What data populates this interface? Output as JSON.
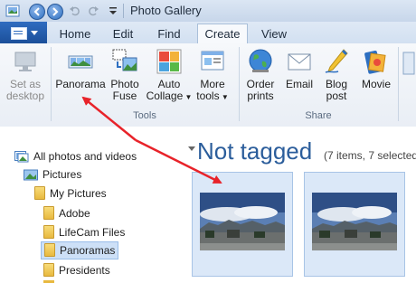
{
  "window": {
    "title": "Photo Gallery"
  },
  "quick_access": {
    "icons": [
      "back-icon",
      "forward-icon",
      "undo-icon",
      "redo-icon",
      "customize-icon"
    ]
  },
  "tabs": [
    {
      "label": "Home"
    },
    {
      "label": "Edit"
    },
    {
      "label": "Find"
    },
    {
      "label": "Create",
      "active": true
    },
    {
      "label": "View"
    }
  ],
  "ribbon": {
    "groups": [
      {
        "label": "",
        "buttons": [
          {
            "label_line1": "Set as",
            "label_line2": "desktop",
            "icon": "desktop-icon",
            "disabled": true
          }
        ]
      },
      {
        "label": "Tools",
        "buttons": [
          {
            "label_line1": "Panorama",
            "label_line2": "",
            "icon": "panorama-icon"
          },
          {
            "label_line1": "Photo",
            "label_line2": "Fuse",
            "icon": "photo-fuse-icon"
          },
          {
            "label_line1": "Auto",
            "label_line2": "Collage",
            "icon": "auto-collage-icon",
            "dropdown": true
          },
          {
            "label_line1": "More",
            "label_line2": "tools",
            "icon": "more-tools-icon",
            "dropdown": true
          }
        ]
      },
      {
        "label": "Share",
        "buttons": [
          {
            "label_line1": "Order",
            "label_line2": "prints",
            "icon": "globe-icon"
          },
          {
            "label_line1": "Email",
            "label_line2": "",
            "icon": "email-icon"
          },
          {
            "label_line1": "Blog",
            "label_line2": "post",
            "icon": "blog-pen-icon"
          },
          {
            "label_line1": "Movie",
            "label_line2": "",
            "icon": "film-icon"
          }
        ]
      }
    ]
  },
  "sidebar": {
    "items": [
      {
        "label": "All photos and videos",
        "icon": "photos-videos-icon",
        "level": 0
      },
      {
        "label": "Pictures",
        "icon": "pictures-library-icon",
        "level": 1
      },
      {
        "label": "My Pictures",
        "icon": "folder-icon",
        "level": 2
      },
      {
        "label": "Adobe",
        "icon": "folder-icon",
        "level": 3
      },
      {
        "label": "LifeCam Files",
        "icon": "folder-icon",
        "level": 3
      },
      {
        "label": "Panoramas",
        "icon": "folder-icon",
        "level": 3,
        "selected": true
      },
      {
        "label": "Presidents",
        "icon": "folder-icon",
        "level": 3
      }
    ]
  },
  "content": {
    "heading": "Not tagged",
    "subheading": "(7 items, 7 selected"
  },
  "colors": {
    "accent": "#2b5d9b",
    "annotation_arrow": "#e8232a",
    "selection": "#cde0f7"
  }
}
